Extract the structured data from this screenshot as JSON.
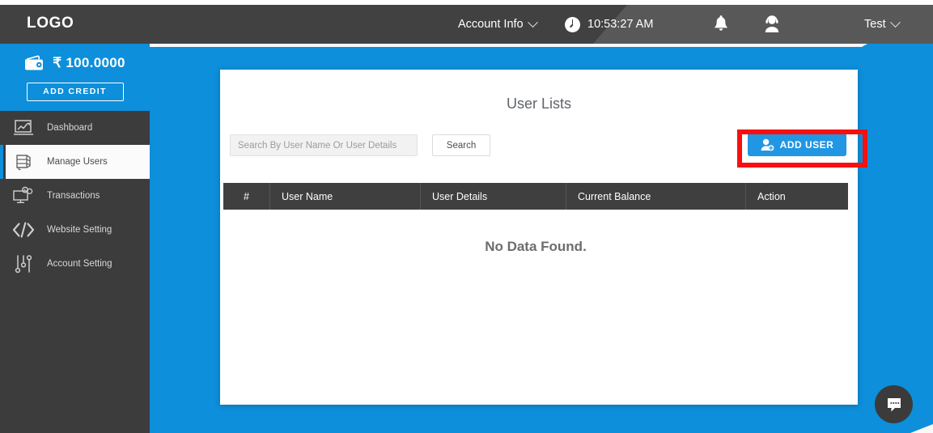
{
  "header": {
    "logo": "LOGO",
    "account_info_label": "Account Info",
    "time": "10:53:27 AM",
    "user_label": "Test",
    "icons": {
      "clock": "clock-icon",
      "bell": "notification-bell-icon",
      "support": "support-agent-icon"
    }
  },
  "sidebar": {
    "credit": {
      "amount": "₹ 100.0000",
      "add_credit_label": "ADD CREDIT",
      "wallet_icon": "wallet-icon"
    },
    "items": [
      {
        "label": "Dashboard",
        "icon": "dashboard-chart-icon",
        "active": false
      },
      {
        "label": "Manage Users",
        "icon": "manage-users-icon",
        "active": true
      },
      {
        "label": "Transactions",
        "icon": "transactions-icon",
        "active": false
      },
      {
        "label": "Website Setting",
        "icon": "code-brackets-icon",
        "active": false
      },
      {
        "label": "Account Setting",
        "icon": "sliders-settings-icon",
        "active": false
      }
    ]
  },
  "card": {
    "title": "User Lists",
    "search": {
      "placeholder": "Search By User Name Or User Details",
      "value": "",
      "button_label": "Search"
    },
    "add_user_label": "ADD USER",
    "add_user_icon": "add-user-icon",
    "table": {
      "columns": [
        "#",
        "User Name",
        "User Details",
        "Current Balance",
        "Action"
      ],
      "rows": [],
      "empty_message": "No Data Found."
    }
  },
  "chat_widget": {
    "icon": "chat-bubble-icon"
  },
  "colors": {
    "accent_blue": "#0d8fdb",
    "button_blue": "#2196e3",
    "header_dark": "#414141",
    "header_light": "#585858",
    "sidebar_dark": "#3c3c3c",
    "table_header": "#3f3f3f",
    "highlight_red": "#fa0f0f"
  }
}
